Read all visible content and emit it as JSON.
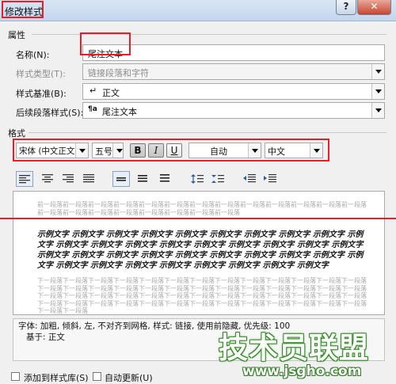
{
  "window": {
    "title": "修改样式",
    "help": "?",
    "close": "✕"
  },
  "properties": {
    "section": "属性",
    "name": {
      "label": "名称(N):",
      "value": "尾注文本"
    },
    "style_type": {
      "label": "样式类型(T):",
      "value": "链接段落和字符"
    },
    "based_on": {
      "label": "样式基准(B):",
      "value": "正文",
      "icon": "paragraph-return-icon"
    },
    "next_para": {
      "label": "后续段落样式(S):",
      "value": "尾注文本",
      "icon": "linked-style-icon"
    }
  },
  "format": {
    "section": "格式",
    "font": "宋体 (中文正文)",
    "size": "五号",
    "bold": "B",
    "italic": "I",
    "underline": "U",
    "color": "自动",
    "language": "中文"
  },
  "toolbar": {
    "icons": [
      "align-left-icon",
      "align-center-icon",
      "align-right-icon",
      "justify-icon",
      "line-single-icon",
      "line-1-5-icon",
      "line-double-icon",
      "spacing-increase-icon",
      "spacing-decrease-icon",
      "indent-decrease-icon",
      "indent-increase-icon"
    ]
  },
  "preview": {
    "prev_para": "前一段落前一段落前一段落前一段落前一段落前一段落前一段落前一段落前一段落前一段落前一段落前一段落前一段落前一段落前一段落前一段落前一段落前一段落前一段落前一段落前一段落",
    "sample": "示例文字 示例文字 示例文字 示例文字 示例文字 示例文字 示例文字 示例文字 示例文字 示例文字 示例文字 示例文字 示例文字 示例文字 示例文字 示例文字 示例文字 示例文字 示例文字 示例文字 示例文字 示例文字 示例文字 示例文字 示例文字 示例文字 示例文字 示例文字 示例文字 示例文字 示例文字 示例文字 示例文字 示例文字 示例文字 示例文字 示例文字",
    "next_para": "下一段落下一段落下一段落下一段落下一段落下一段落下一段落下一段落下一段落下一段落下一段落下一段落下一段落下一段落下一段落下一段落下一段落下一段落下一段落下一段落下一段落下一段落下一段落下一段落下一段落下一段落下一段落下一段落下一段落下一段落下一段落下一段落下一段落下一段落下一段落下一段落下一段落下一段落下一段落下一段落下一段落下一段落下一段落下一段落下一段落下一段落下一段落下一段落下一段落下一段落下一段落下一段落下一段落下一段落"
  },
  "description": {
    "line1": "字体: 加粗, 倾斜, 左, 不对齐到网格, 样式: 链接, 使用前隐藏, 优先级: 100",
    "line2": "基于: 正文"
  },
  "options": {
    "add_to_gallery": "添加到样式库(S)",
    "auto_update": "自动更新(U)"
  },
  "watermark": {
    "main": "技术员联盟",
    "url": "www.jsgho.com"
  },
  "colors": {
    "highlight": "#e0202a",
    "watermark": "#2f7e22"
  }
}
